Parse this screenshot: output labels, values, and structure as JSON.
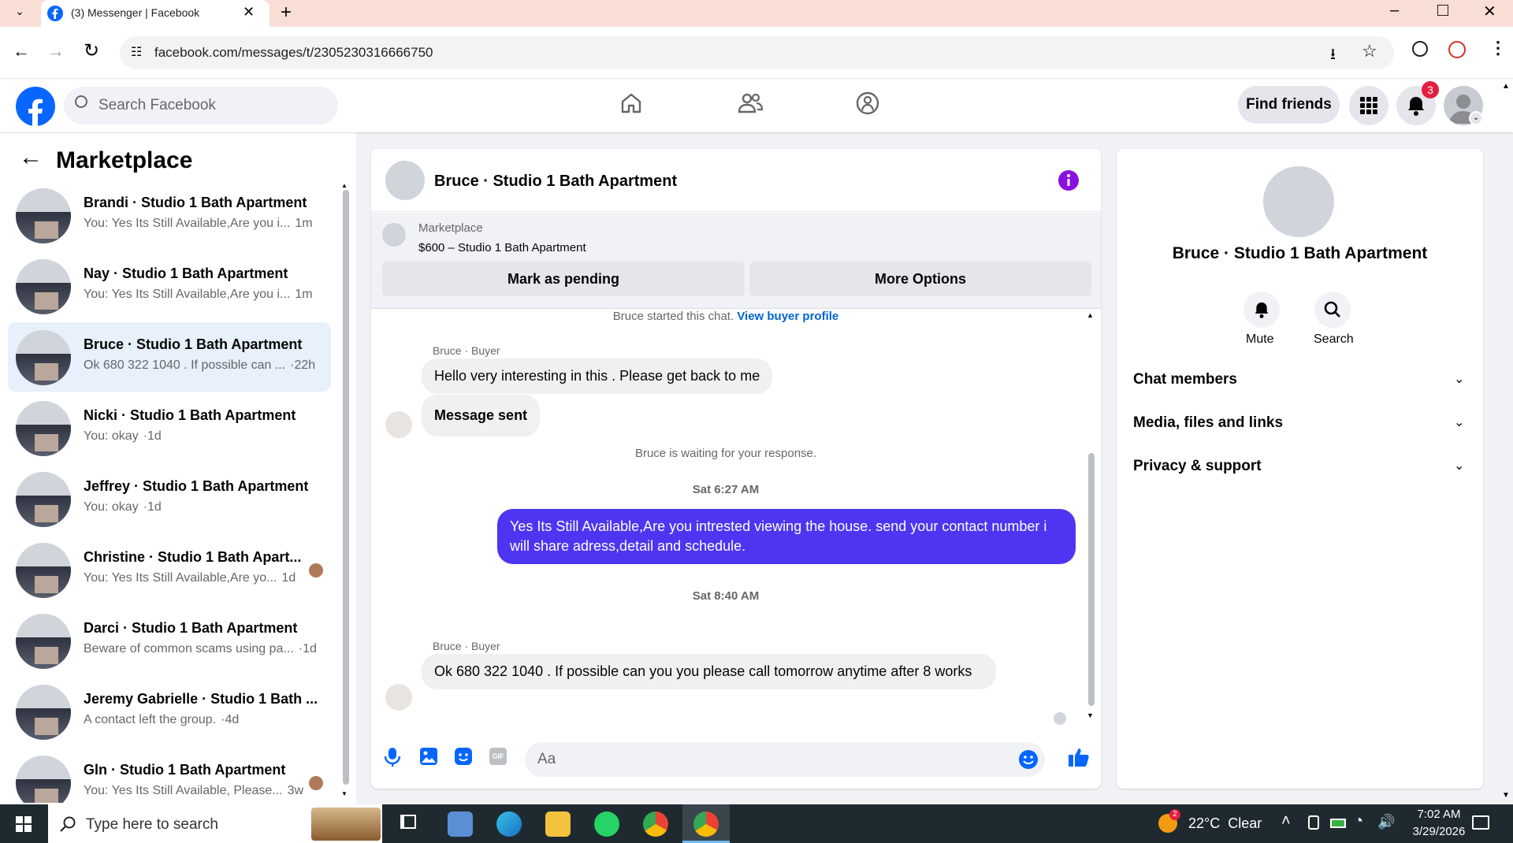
{
  "browser": {
    "tab_title": "(3) Messenger | Facebook",
    "url": "facebook.com/messages/t/2305230316666750"
  },
  "fb_header": {
    "search_placeholder": "Search Facebook",
    "find_friends": "Find friends",
    "notification_count": "3"
  },
  "left": {
    "title": "Marketplace",
    "conversations": [
      {
        "name": "Brandi · Studio 1 Bath Apartment",
        "snippet": "You: Yes Its Still Available,Are you i...",
        "time": "1m"
      },
      {
        "name": "Nay · Studio 1 Bath Apartment",
        "snippet": "You: Yes Its Still Available,Are you i...",
        "time": "1m"
      },
      {
        "name": "Bruce · Studio 1 Bath Apartment",
        "snippet": "Ok 680 322 1040 . If possible can ...",
        "time": "·22h"
      },
      {
        "name": "Nicki · Studio 1 Bath Apartment",
        "snippet": "You: okay",
        "time": "·1d"
      },
      {
        "name": "Jeffrey · Studio 1 Bath Apartment",
        "snippet": "You: okay",
        "time": "·1d"
      },
      {
        "name": "Christine · Studio 1 Bath Apart...",
        "snippet": "You: Yes Its Still Available,Are yo...",
        "time": "1d"
      },
      {
        "name": "Darci · Studio 1 Bath Apartment",
        "snippet": "Beware of common scams using pa...",
        "time": "·1d"
      },
      {
        "name": "Jeremy Gabrielle · Studio 1 Bath ...",
        "snippet": "A contact left the group.",
        "time": "·4d"
      },
      {
        "name": "Gln · Studio 1 Bath Apartment",
        "snippet": "You: Yes Its Still Available, Please...",
        "time": "3w"
      }
    ]
  },
  "chat": {
    "title": "Bruce · Studio 1 Bath Apartment",
    "listing_source": "Marketplace",
    "listing": "$600 – Studio 1 Bath Apartment",
    "mark_pending": "Mark as pending",
    "more_options": "More Options",
    "started_text": "Bruce started this chat.",
    "view_profile": "View buyer profile",
    "sender_label": "Bruce · Buyer",
    "msg1": "Hello  very interesting  in this  . Please  get back to me",
    "msg2": "Message sent",
    "waiting": "Bruce is waiting for your response.",
    "time1": "Sat 6:27 AM",
    "msg3": "Yes Its Still Available,Are you intrested viewing the house. send your contact number i will share adress,detail and schedule.",
    "time2": "Sat 8:40 AM",
    "sender_label2": "Bruce · Buyer",
    "msg4": "Ok 680 322 1040  .  If possible    can you you please call  tomorrow  anytime after  8 works",
    "input_placeholder": "Aa"
  },
  "right": {
    "name": "Bruce · Studio 1 Bath Apartment",
    "mute": "Mute",
    "search": "Search",
    "sections": [
      "Chat members",
      "Media, files and links",
      "Privacy & support"
    ]
  },
  "taskbar": {
    "search_placeholder": "Type here to search",
    "weather": "22°C  Clear",
    "weather_badge": "2",
    "time": "7:02 AM",
    "date": "3/29/2026"
  },
  "colors": {
    "fb_blue": "#0866ff",
    "accent_purple": "#4d35f2",
    "notif_red": "#e41e3f"
  }
}
